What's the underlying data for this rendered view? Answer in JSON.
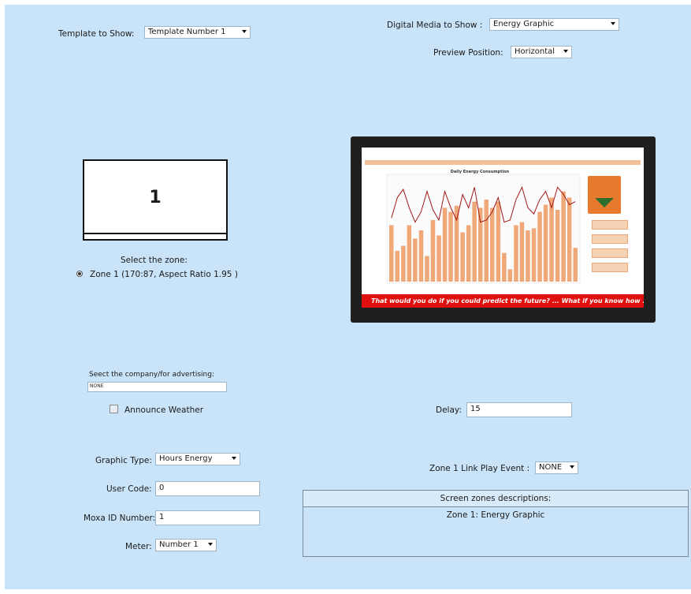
{
  "template": {
    "label": "Template to Show:",
    "value": "Template Number 1"
  },
  "digital_media": {
    "label": "Digital Media to Show :",
    "value": "Energy Graphic"
  },
  "preview_position": {
    "label": "Preview Position:",
    "value": "Horizontal"
  },
  "zone_preview": {
    "number": "1"
  },
  "zone_select": {
    "label": "Select the zone:",
    "option": "Zone 1 (170:87, Aspect Ratio 1.95 )"
  },
  "monitor": {
    "chart_title": "Daily Energy Consumption",
    "ticker": "That would you do if you could predict the future? ... What if you know how ...",
    "bar_values": [
      0.55,
      0.3,
      0.35,
      0.55,
      0.42,
      0.5,
      0.25,
      0.6,
      0.45,
      0.72,
      0.68,
      0.74,
      0.48,
      0.55,
      0.78,
      0.72,
      0.8,
      0.72,
      0.78,
      0.28,
      0.12,
      0.55,
      0.58,
      0.5,
      0.52,
      0.68,
      0.75,
      0.82,
      0.7,
      0.88,
      0.82,
      0.33
    ],
    "line_values": [
      0.62,
      0.82,
      0.9,
      0.72,
      0.58,
      0.68,
      0.88,
      0.7,
      0.6,
      0.88,
      0.72,
      0.6,
      0.85,
      0.72,
      0.92,
      0.58,
      0.6,
      0.68,
      0.82,
      0.58,
      0.6,
      0.8,
      0.92,
      0.72,
      0.66,
      0.8,
      0.88,
      0.72,
      0.92,
      0.85,
      0.75,
      0.78
    ]
  },
  "company": {
    "label": "Seect the company/for advertising:",
    "value": "NONE"
  },
  "announce_weather": {
    "label": "Announce Weather",
    "checked": false
  },
  "delay": {
    "label": "Delay:",
    "value": "15"
  },
  "graphic_type": {
    "label": "Graphic Type:",
    "value": "Hours Energy"
  },
  "user_code": {
    "label": "User Code:",
    "value": "0"
  },
  "moxa_id": {
    "label": "Moxa ID Number:",
    "value": "1"
  },
  "meter": {
    "label": "Meter:",
    "value": "Number 1"
  },
  "zone_link": {
    "label": "Zone 1 Link Play Event :",
    "value": "NONE"
  },
  "zones_desc": {
    "header": "Screen zones descriptions:",
    "body": "Zone 1: Energy Graphic"
  }
}
